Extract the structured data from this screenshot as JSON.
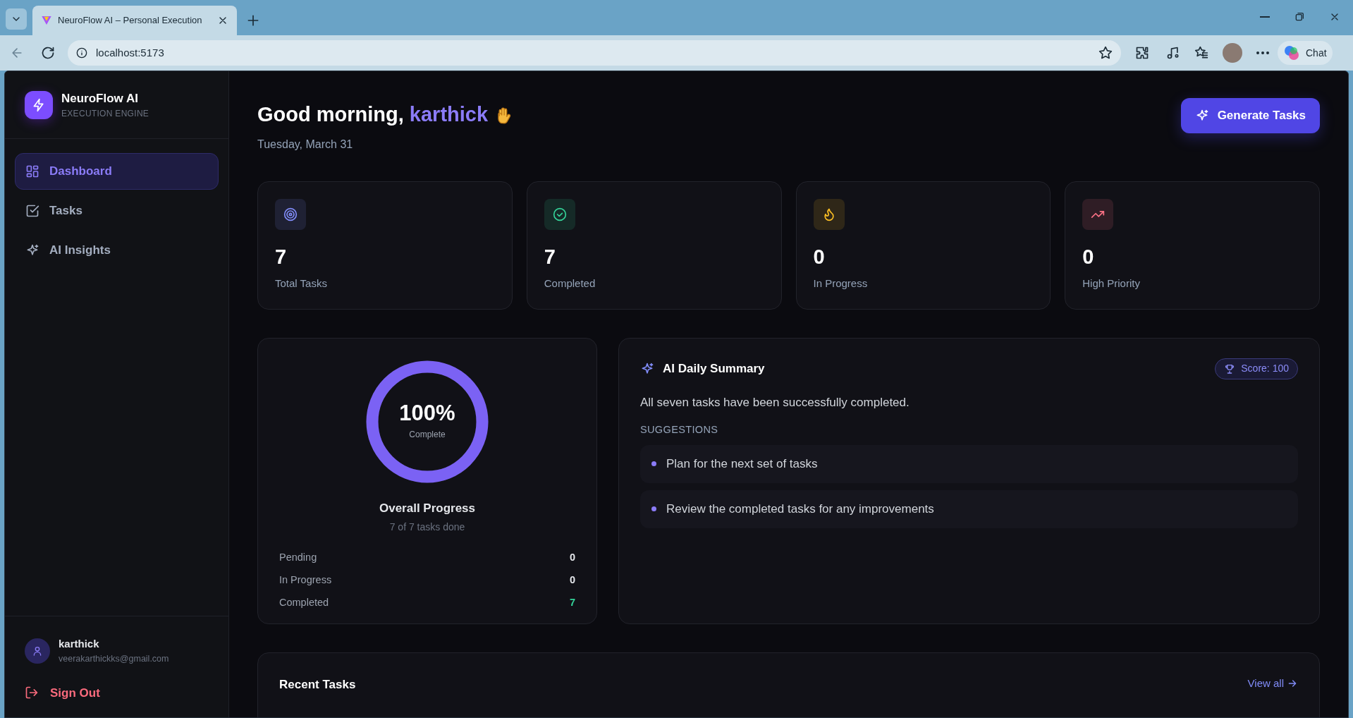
{
  "browser": {
    "tab_title": "NeuroFlow AI – Personal Execution",
    "url": "localhost:5173",
    "chat_label": "Chat"
  },
  "sidebar": {
    "brand": "NeuroFlow AI",
    "tagline": "EXECUTION ENGINE",
    "items": [
      {
        "label": "Dashboard",
        "selected": true
      },
      {
        "label": "Tasks",
        "selected": false
      },
      {
        "label": "AI Insights",
        "selected": false
      }
    ],
    "user": {
      "name": "karthick",
      "email": "veerakarthickks@gmail.com"
    },
    "sign_out": "Sign Out"
  },
  "header": {
    "greeting": "Good morning, ",
    "name": "karthick",
    "date": "Tuesday, March 31",
    "button": "Generate Tasks"
  },
  "stats": [
    {
      "kind": "target",
      "value": "7",
      "label": "Total Tasks",
      "color": "#818cf8"
    },
    {
      "kind": "check",
      "value": "7",
      "label": "Completed",
      "color": "#34d399"
    },
    {
      "kind": "flame",
      "value": "0",
      "label": "In Progress",
      "color": "#fbbf24"
    },
    {
      "kind": "trend",
      "value": "0",
      "label": "High Priority",
      "color": "#fb7185"
    }
  ],
  "progress": {
    "level": 1,
    "percent": "100%",
    "caption": "Complete",
    "title": "Overall Progress",
    "subtitle": "7 of 7 tasks done",
    "rows": [
      {
        "label": "Pending",
        "value": "0",
        "highlight": false
      },
      {
        "label": "In Progress",
        "value": "0",
        "highlight": false
      },
      {
        "label": "Completed",
        "value": "7",
        "highlight": true
      }
    ]
  },
  "summary": {
    "title": "AI Daily Summary",
    "score": "Score: 100",
    "text": "All seven tasks have been successfully completed.",
    "suggestions_heading": "SUGGESTIONS",
    "suggestions": [
      "Plan for the next set of tasks",
      "Review the completed tasks for any improvements"
    ]
  },
  "recent": {
    "title": "Recent Tasks",
    "link": "View all"
  }
}
